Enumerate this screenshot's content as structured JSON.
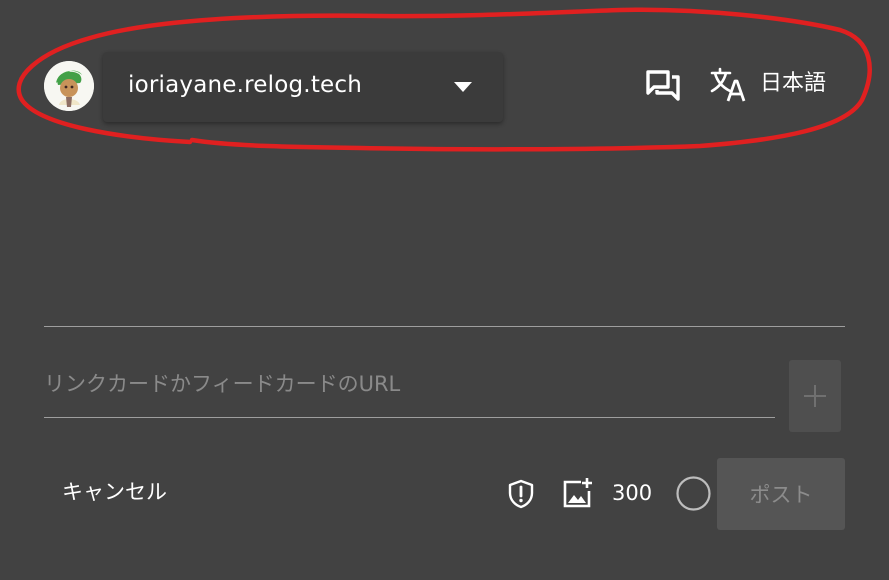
{
  "header": {
    "account": {
      "avatar_icon": "avatar",
      "handle": "ioriayane.relog.tech",
      "dropdown_icon": "caret-down-icon"
    },
    "threads_icon": "threads-icon",
    "language": {
      "icon": "translate-icon",
      "label": "日本語"
    }
  },
  "composer": {
    "text": "",
    "link_card": {
      "placeholder": "リンクカードかフィードカードのURL",
      "value": "",
      "add_icon": "plus-icon"
    }
  },
  "footer": {
    "cancel_label": "キャンセル",
    "moderation_icon": "shield-alert-icon",
    "add_image_icon": "image-plus-icon",
    "remaining_chars": "300",
    "progress_fraction": 0,
    "post_label": "ポスト"
  },
  "colors": {
    "background": "#424242",
    "annotation": "#e02020",
    "text": "#ffffff",
    "disabled_button": "#555555",
    "disabled_text": "#8c8c8c",
    "divider": "#9e9e9e"
  }
}
